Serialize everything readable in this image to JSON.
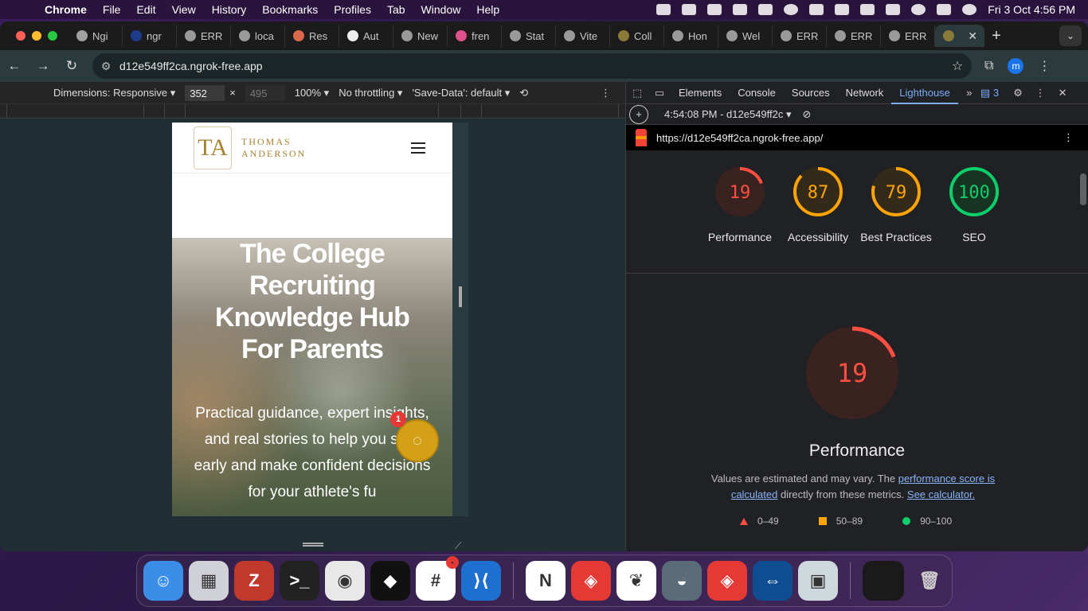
{
  "menubar": {
    "items": [
      "Chrome",
      "File",
      "Edit",
      "View",
      "History",
      "Bookmarks",
      "Profiles",
      "Tab",
      "Window",
      "Help"
    ],
    "clock": "Fri 3 Oct  4:56 PM"
  },
  "tabs": [
    {
      "label": "Ngi",
      "fav": "#a0a0a0"
    },
    {
      "label": "ngr",
      "fav": "#1e3a8a"
    },
    {
      "label": "ERR",
      "fav": "#9a9a9a"
    },
    {
      "label": "loca",
      "fav": "#9a9a9a"
    },
    {
      "label": "Res",
      "fav": "#d9694a"
    },
    {
      "label": "Aut",
      "fav": "#eeeeee"
    },
    {
      "label": "New",
      "fav": "#9a9a9a"
    },
    {
      "label": "fren",
      "fav": "#e0508a"
    },
    {
      "label": "Stat",
      "fav": "#9a9a9a"
    },
    {
      "label": "Vite",
      "fav": "#9a9a9a"
    },
    {
      "label": "Coll",
      "fav": "#8a7a3a"
    },
    {
      "label": "Hon",
      "fav": "#9a9a9a"
    },
    {
      "label": "Wel",
      "fav": "#9a9a9a"
    },
    {
      "label": "ERR",
      "fav": "#9a9a9a"
    },
    {
      "label": "ERR",
      "fav": "#9a9a9a"
    },
    {
      "label": "ERR",
      "fav": "#9a9a9a"
    }
  ],
  "active_tab": {
    "close": "✕"
  },
  "omnibox": {
    "url": "d12e549ff2ca.ngrok-free.app"
  },
  "profile_initial": "m",
  "device_toolbar": {
    "dimensions": "Dimensions: Responsive",
    "width": "352",
    "times": "×",
    "height": "495",
    "zoom": "100%",
    "throttling": "No throttling",
    "save_data": "'Save-Data': default"
  },
  "site": {
    "logo_mark": "TA",
    "logo_line1": "THOMAS",
    "logo_line2": "ANDERSON",
    "hero_title": "The College Recruiting Knowledge Hub For Parents",
    "hero_text": "Practical guidance, expert insights, and real stories to help you start early and make confident decisions for your athlete's fu",
    "chat_badge": "1"
  },
  "devtools": {
    "tabs": [
      "Elements",
      "Console",
      "Sources",
      "Network",
      "Lighthouse"
    ],
    "active": "Lighthouse",
    "issues_count": "3",
    "report_time": "4:54:08 PM - d12e549ff2c",
    "report_url": "https://d12e549ff2ca.ngrok-free.app/",
    "scores": [
      {
        "label": "Performance",
        "value": "19",
        "color": "#ff4e42",
        "bg": "#3a2220",
        "ratio": 0.19
      },
      {
        "label": "Accessibility",
        "value": "87",
        "color": "#ffa400",
        "bg": "#332a1a",
        "ratio": 0.87
      },
      {
        "label": "Best Practices",
        "value": "79",
        "color": "#ffa400",
        "bg": "#332a1a",
        "ratio": 0.79
      },
      {
        "label": "SEO",
        "value": "100",
        "color": "#0cce6b",
        "bg": "#173322",
        "ratio": 1.0
      }
    ],
    "main_score": "19",
    "main_title": "Performance",
    "desc_prefix": "Values are estimated and may vary. The ",
    "desc_link1": "performance score is calculated",
    "desc_mid": " directly from these metrics. ",
    "desc_link2": "See calculator.",
    "legend": [
      "0–49",
      "50–89",
      "90–100"
    ]
  },
  "dock": [
    {
      "name": "finder",
      "bg": "#3b8ee8",
      "glyph": "☺"
    },
    {
      "name": "launchpad",
      "bg": "#d0d0d8",
      "glyph": "▦"
    },
    {
      "name": "filezilla",
      "bg": "#c0392b",
      "glyph": "Z"
    },
    {
      "name": "terminal",
      "bg": "#222222",
      "glyph": ">_"
    },
    {
      "name": "chrome",
      "bg": "#e8e8e8",
      "glyph": "◉"
    },
    {
      "name": "unity",
      "bg": "#111111",
      "glyph": "◆"
    },
    {
      "name": "slack",
      "bg": "#ffffff",
      "glyph": "#"
    },
    {
      "name": "vscode",
      "bg": "#1f6fd0",
      "glyph": "⟩⟨"
    },
    {
      "name": "notion",
      "bg": "#ffffff",
      "glyph": "N"
    },
    {
      "name": "anydesk",
      "bg": "#e53935",
      "glyph": "◈"
    },
    {
      "name": "mongodb",
      "bg": "#ffffff",
      "glyph": "❦"
    },
    {
      "name": "dbngin",
      "bg": "#5a6b7a",
      "glyph": "◒"
    },
    {
      "name": "anydesk2",
      "bg": "#e53935",
      "glyph": "◈"
    },
    {
      "name": "teamviewer",
      "bg": "#0e4d92",
      "glyph": "⇔"
    },
    {
      "name": "preview",
      "bg": "#cfd8dc",
      "glyph": "▣"
    }
  ],
  "slack_badge": "•"
}
